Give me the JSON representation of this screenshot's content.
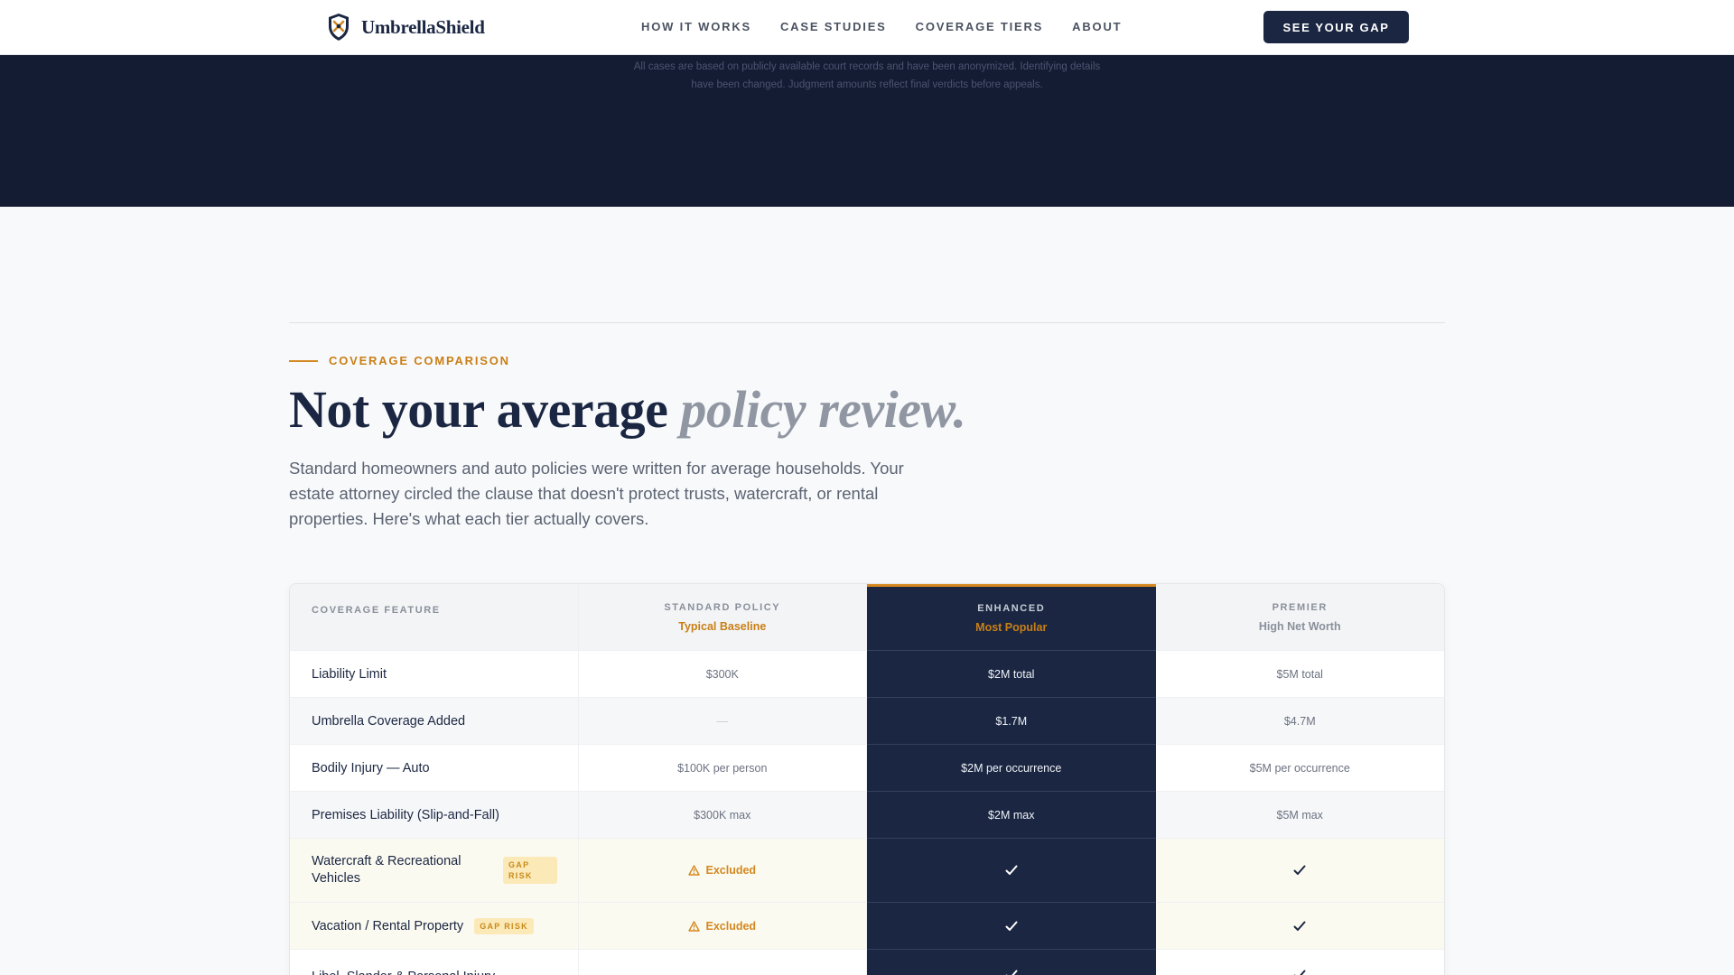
{
  "brand": {
    "name": "UmbrellaShield"
  },
  "nav": {
    "links": [
      "HOW IT WORKS",
      "CASE STUDIES",
      "COVERAGE TIERS",
      "ABOUT"
    ],
    "cta": "SEE YOUR GAP"
  },
  "hero": {
    "disclaimer": "All cases are based on publicly available court records and have been anonymized. Identifying details have been changed. Judgment amounts reflect final verdicts before appeals."
  },
  "section": {
    "eyebrow": "COVERAGE COMPARISON",
    "headline_main": "Not your average ",
    "headline_accent": "policy review.",
    "lede": "Standard homeowners and auto policies were written for average households. Your estate attorney circled the clause that doesn't protect trusts, watercraft, or rental properties. Here's what each tier actually covers."
  },
  "table": {
    "header": {
      "feature": "COVERAGE FEATURE",
      "standard": {
        "title": "STANDARD POLICY",
        "sub": "Typical Baseline"
      },
      "enhanced": {
        "title": "ENHANCED",
        "sub": "Most Popular"
      },
      "premier": {
        "title": "PREMIER",
        "sub": "High Net Worth"
      }
    },
    "rows": [
      {
        "feature": "Liability Limit",
        "standard": "$300K",
        "enhanced": "$2M total",
        "premier": "$5M total"
      },
      {
        "feature": "Umbrella Coverage Added",
        "standard": "—",
        "enhanced": "$1.7M",
        "premier": "$4.7M"
      },
      {
        "feature": "Bodily Injury — Auto",
        "standard": "$100K per person",
        "enhanced": "$2M per occurrence",
        "premier": "$5M per occurrence"
      },
      {
        "feature": "Premises Liability (Slip-and-Fall)",
        "standard": "$300K max",
        "enhanced": "$2M max",
        "premier": "$5M max"
      },
      {
        "feature": "Watercraft & Recreational Vehicles",
        "badge": "GAP RISK",
        "standard": "Excluded"
      },
      {
        "feature": "Vacation / Rental Property",
        "badge": "GAP RISK",
        "standard": "Excluded"
      },
      {
        "feature": "Libel, Slander & Personal Injury",
        "standard": "—"
      }
    ]
  },
  "colors": {
    "navy": "#1b2742",
    "accent": "#d4881f",
    "hero": "#141c33"
  }
}
